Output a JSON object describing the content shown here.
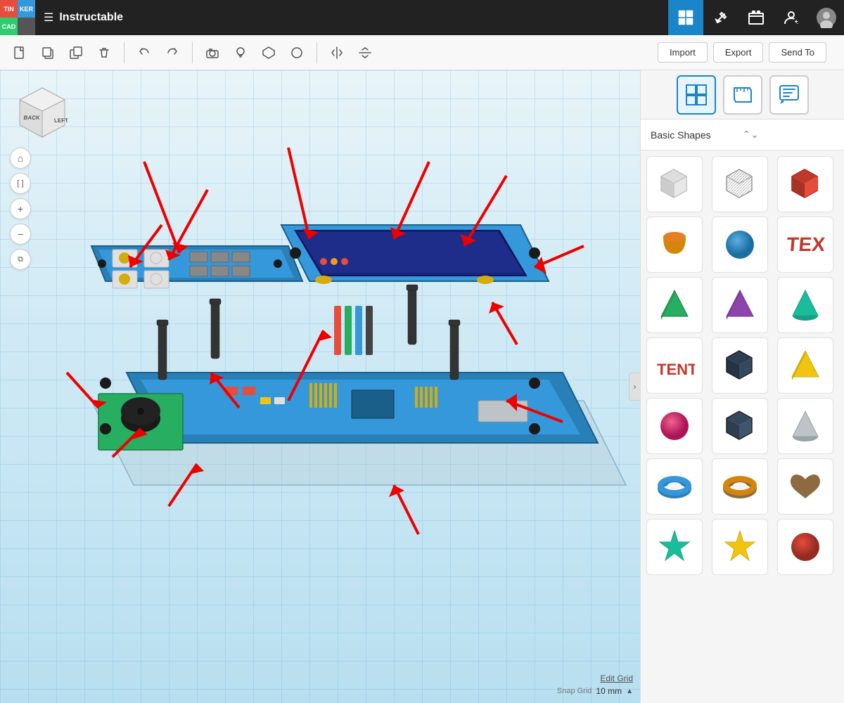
{
  "app": {
    "title": "Instructable",
    "logo": [
      "TIN",
      "KER",
      "CAD"
    ],
    "logo_cells": [
      {
        "letter": "T",
        "color": "#e74c3c"
      },
      {
        "letter": "I",
        "color": "#3498db"
      },
      {
        "letter": "N",
        "color": "#2ecc71"
      },
      {
        "letter": "K",
        "color": "#f39c12"
      },
      {
        "letter": "E",
        "color": "#e74c3c"
      },
      {
        "letter": "R",
        "color": "#3498db"
      },
      {
        "letter": "C",
        "color": "#2ecc71"
      },
      {
        "letter": "A",
        "color": "#f39c12"
      },
      {
        "letter": "D",
        "color": "#888888"
      }
    ]
  },
  "toolbar": {
    "tools": [
      "new",
      "copy",
      "duplicate",
      "delete",
      "undo",
      "redo",
      "camera",
      "bulb",
      "polygon",
      "circle",
      "mirror",
      "flip"
    ]
  },
  "actions": {
    "import_label": "Import",
    "export_label": "Export",
    "send_to_label": "Send To"
  },
  "panel": {
    "category_label": "Basic Shapes",
    "icons": [
      "grid-icon",
      "ruler-icon",
      "chat-icon"
    ]
  },
  "shapes": [
    {
      "id": "box-solid",
      "color": "#ccc",
      "type": "box-solid"
    },
    {
      "id": "box-hole",
      "color": "#aaa",
      "type": "box-hole"
    },
    {
      "id": "box-red",
      "color": "#c0392b",
      "type": "box-red"
    },
    {
      "id": "cylinder",
      "color": "#d4860a",
      "type": "cylinder"
    },
    {
      "id": "sphere",
      "color": "#2980b9",
      "type": "sphere"
    },
    {
      "id": "text3d",
      "color": "#777",
      "type": "text3d"
    },
    {
      "id": "pyramid-green",
      "color": "#27ae60",
      "type": "pyramid-green"
    },
    {
      "id": "pyramid-purple",
      "color": "#8e44ad",
      "type": "pyramid-purple"
    },
    {
      "id": "cone-teal",
      "color": "#1abc9c",
      "type": "cone-teal"
    },
    {
      "id": "tent-red",
      "color": "#e74c3c",
      "type": "tent-red"
    },
    {
      "id": "box-dark-blue",
      "color": "#2c3e50",
      "type": "box-dark-blue"
    },
    {
      "id": "pyramid-yellow",
      "color": "#f1c40f",
      "type": "pyramid-yellow"
    },
    {
      "id": "sphere-magenta",
      "color": "#e91e8c",
      "type": "sphere-magenta"
    },
    {
      "id": "box-navy",
      "color": "#34495e",
      "type": "box-navy"
    },
    {
      "id": "cone-grey",
      "color": "#bdc3c7",
      "type": "cone-grey"
    },
    {
      "id": "torus",
      "color": "#2980b9",
      "type": "torus"
    },
    {
      "id": "donut-brown",
      "color": "#d4860a",
      "type": "donut-brown"
    },
    {
      "id": "heart",
      "color": "#8d6a3f",
      "type": "heart"
    },
    {
      "id": "star-teal",
      "color": "#1abc9c",
      "type": "star-teal"
    },
    {
      "id": "star-yellow",
      "color": "#f1c40f",
      "type": "star-yellow"
    },
    {
      "id": "sphere-red2",
      "color": "#c0392b",
      "type": "sphere-red2"
    }
  ],
  "viewport": {
    "snap_grid_label": "Snap Grid",
    "snap_grid_value": "10 mm",
    "edit_grid_label": "Edit Grid"
  },
  "nav_cube": {
    "back_label": "BACK",
    "left_label": "LEFT"
  }
}
